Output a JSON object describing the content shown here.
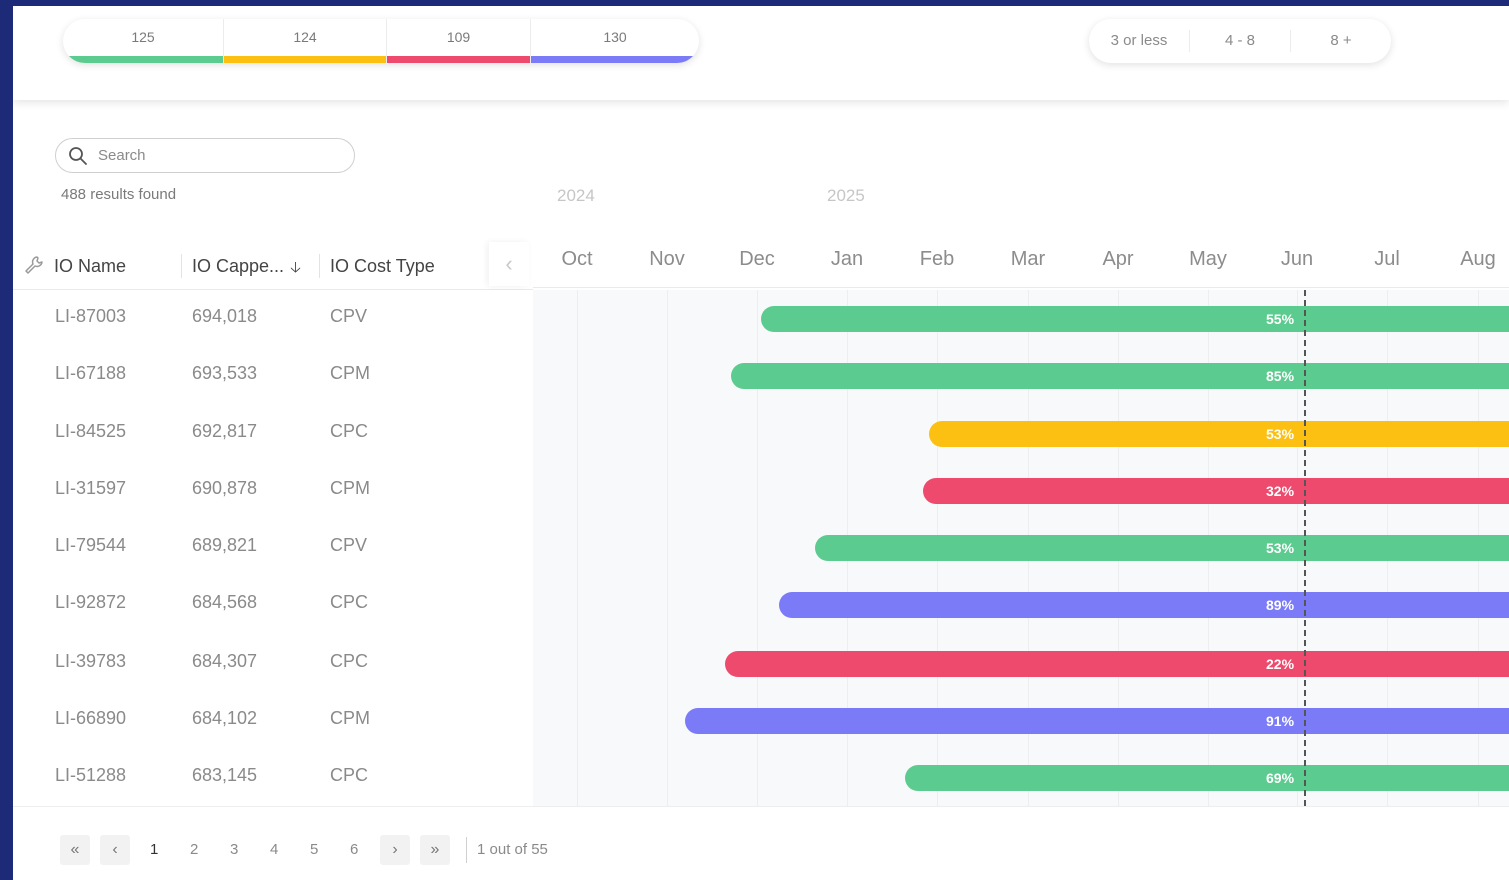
{
  "status_summary": [
    {
      "count": "125",
      "color": "#5ccb8f"
    },
    {
      "count": "124",
      "color": "#fcc012"
    },
    {
      "count": "109",
      "color": "#ee4a6d"
    },
    {
      "count": "130",
      "color": "#7b7bf7"
    }
  ],
  "range_filter": [
    "3 or less",
    "4 - 8",
    "8 +"
  ],
  "search": {
    "placeholder": "Search",
    "results_text": "488 results found"
  },
  "years": [
    "2024",
    "2025"
  ],
  "columns": [
    "IO Name",
    "IO Cappe...",
    "IO Cost Type"
  ],
  "months": [
    "Oct",
    "Nov",
    "Dec",
    "Jan",
    "Feb",
    "Mar",
    "Apr",
    "May",
    "Jun",
    "Jul",
    "Aug"
  ],
  "rows": [
    {
      "name": "LI-87003",
      "capped": "694,018",
      "cost_type": "CPV",
      "percent": "55%",
      "color": "#5ccb8f"
    },
    {
      "name": "LI-67188",
      "capped": "693,533",
      "cost_type": "CPM",
      "percent": "85%",
      "color": "#5ccb8f"
    },
    {
      "name": "LI-84525",
      "capped": "692,817",
      "cost_type": "CPC",
      "percent": "53%",
      "color": "#fcc012"
    },
    {
      "name": "LI-31597",
      "capped": "690,878",
      "cost_type": "CPM",
      "percent": "32%",
      "color": "#ee4a6d"
    },
    {
      "name": "LI-79544",
      "capped": "689,821",
      "cost_type": "CPV",
      "percent": "53%",
      "color": "#5ccb8f"
    },
    {
      "name": "LI-92872",
      "capped": "684,568",
      "cost_type": "CPC",
      "percent": "89%",
      "color": "#7b7bf7"
    },
    {
      "name": "LI-39783",
      "capped": "684,307",
      "cost_type": "CPC",
      "percent": "22%",
      "color": "#ee4a6d"
    },
    {
      "name": "LI-66890",
      "capped": "684,102",
      "cost_type": "CPM",
      "percent": "91%",
      "color": "#7b7bf7"
    },
    {
      "name": "LI-51288",
      "capped": "683,145",
      "cost_type": "CPC",
      "percent": "69%",
      "color": "#5ccb8f"
    }
  ],
  "pagination": {
    "pages": [
      "1",
      "2",
      "3",
      "4",
      "5",
      "6"
    ],
    "current": "1",
    "info": "1 out of 55"
  }
}
